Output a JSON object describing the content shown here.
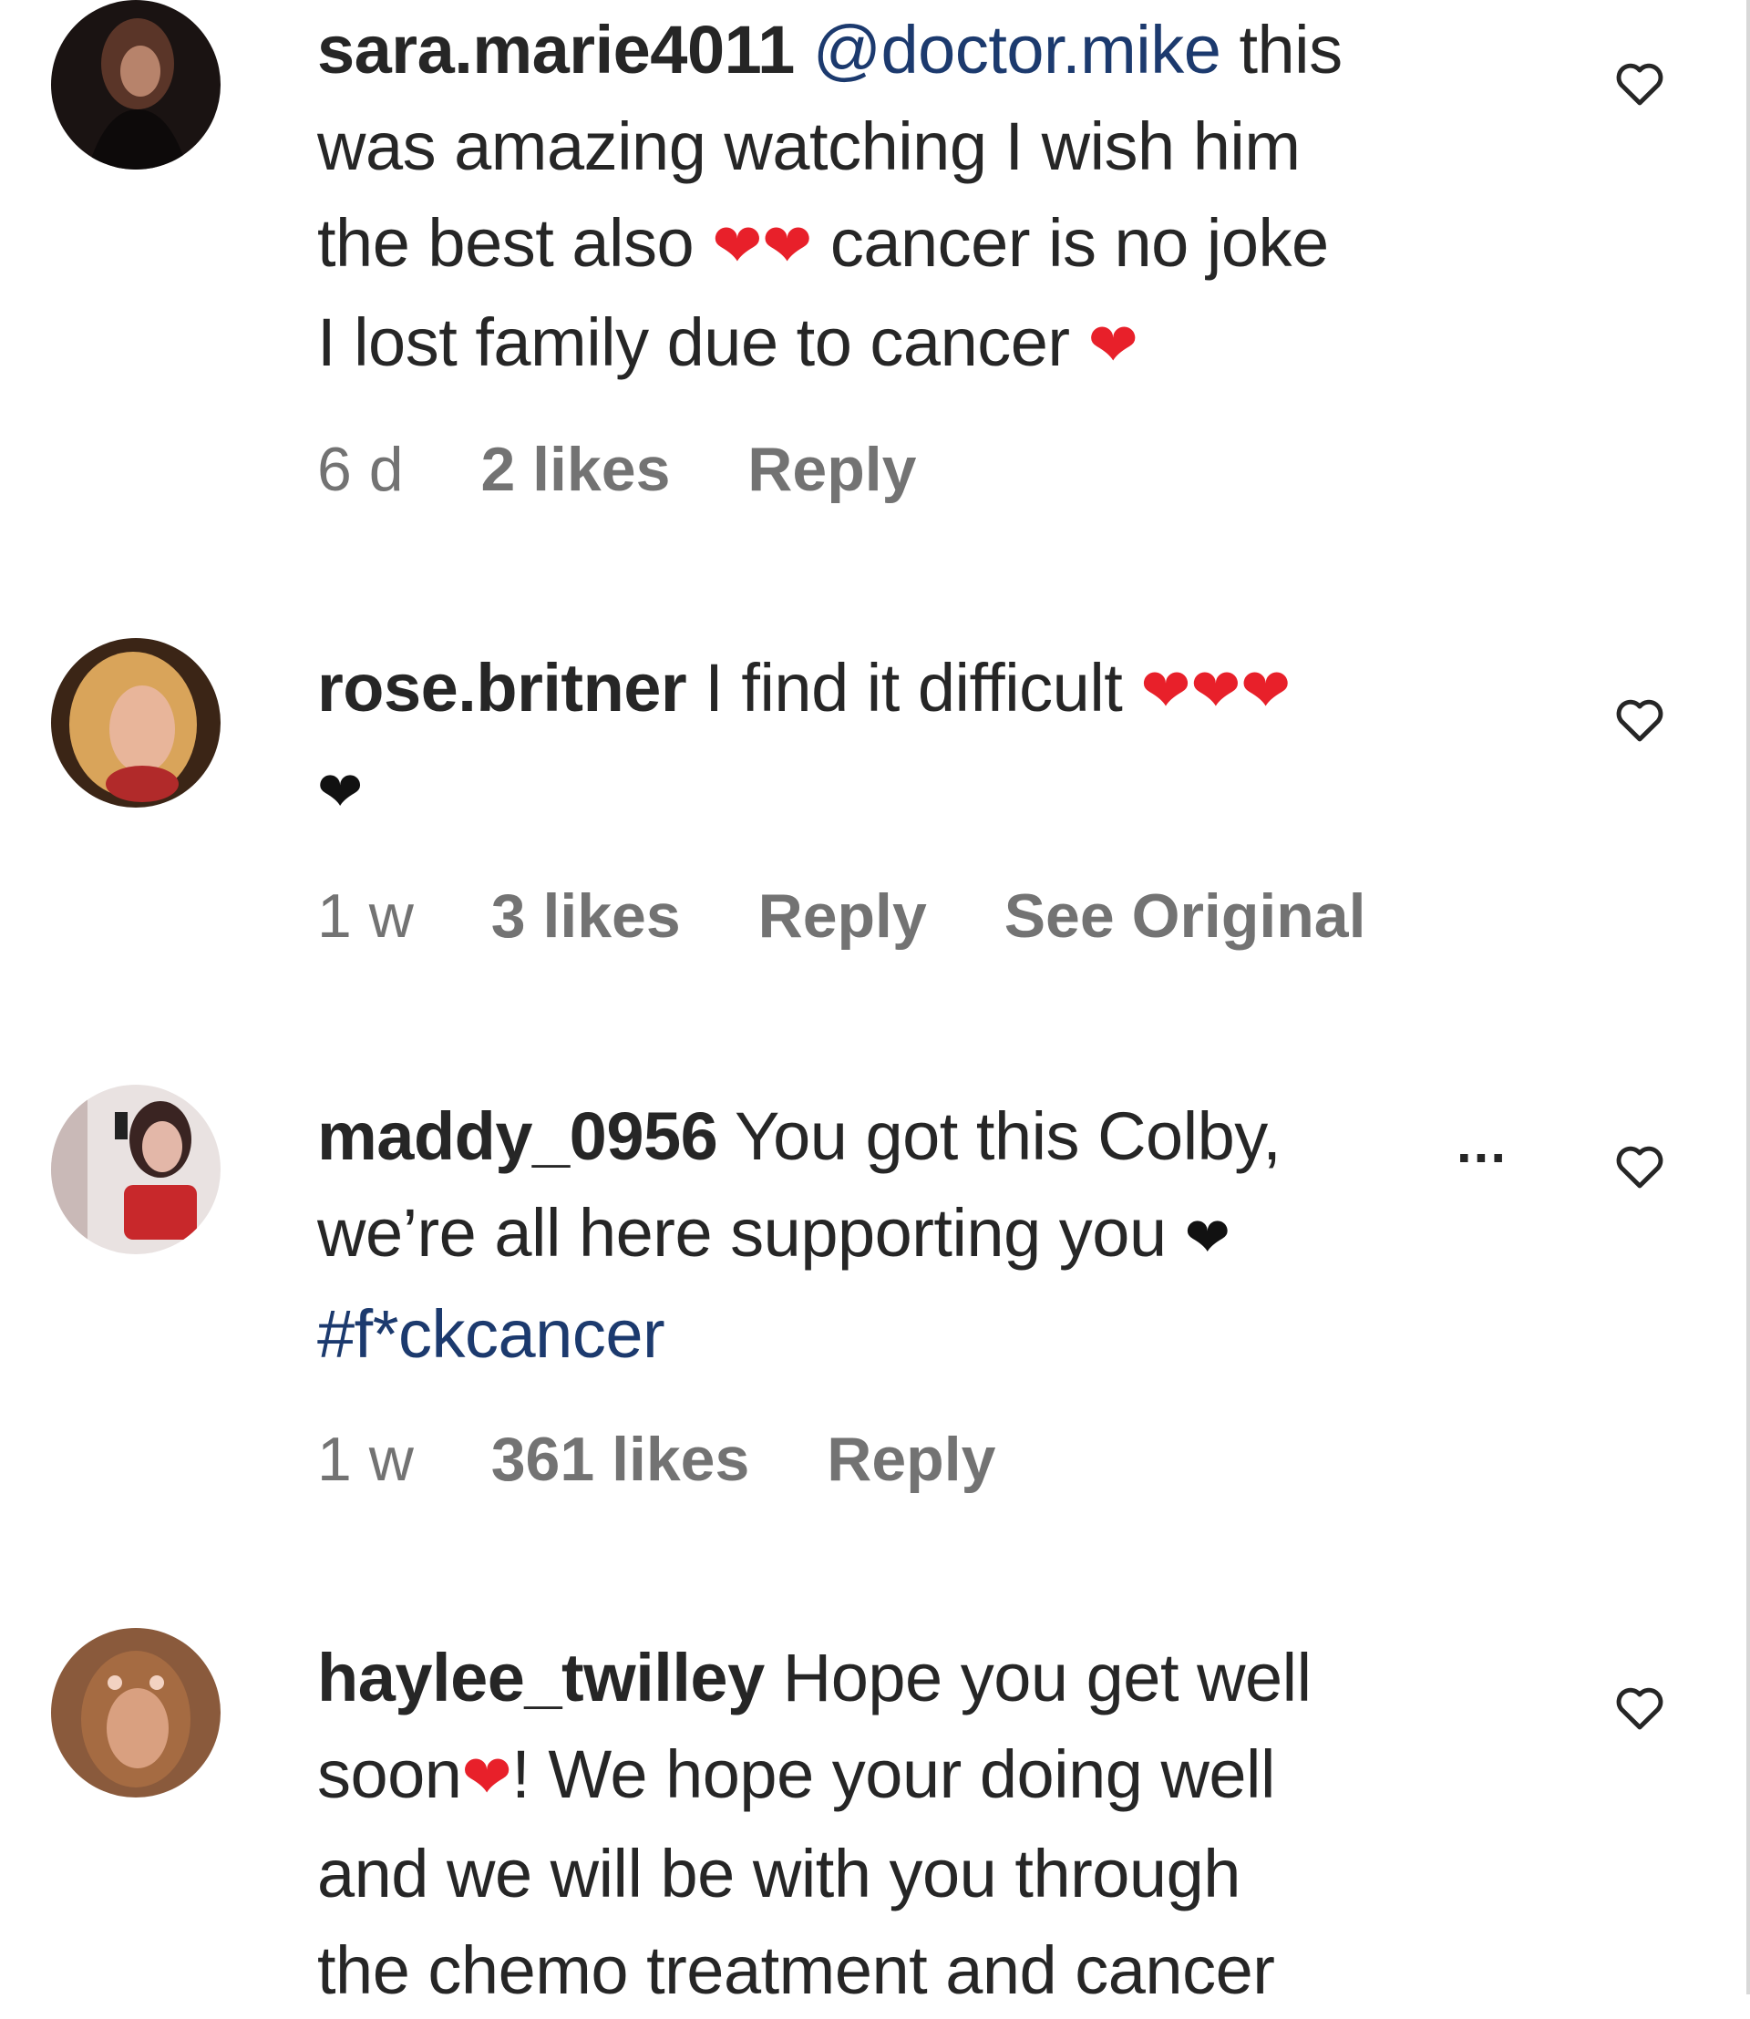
{
  "comments": [
    {
      "username": "sara.marie4011",
      "mention": "@doctor.mike",
      "text_1": "this",
      "text_2": "was amazing watching I wish him",
      "text_3": "the best also",
      "text_4": "cancer is no joke",
      "text_5": "I lost family due to cancer",
      "time": "6 d",
      "likes": "2 likes",
      "reply": "Reply"
    },
    {
      "username": "rose.britner",
      "text_1": "I find it difficult",
      "time": "1 w",
      "likes": "3 likes",
      "reply": "Reply",
      "see_original": "See Original"
    },
    {
      "username": "maddy_0956",
      "text_1": "You got this Colby,",
      "text_2": "we’re all here supporting you",
      "hashtag": "#f*ckcancer",
      "more": "...",
      "time": "1 w",
      "likes": "361 likes",
      "reply": "Reply"
    },
    {
      "username": "haylee_twilley",
      "text_1": "Hope you get well",
      "text_2": "soon",
      "text_3": "! We hope your doing well",
      "text_4": "and we will be with you through",
      "text_5": "the chemo treatment and cancer"
    }
  ],
  "icons": {
    "like": "heart-outline-icon",
    "red_heart": "red-heart-emoji",
    "black_heart": "black-heart-emoji"
  },
  "colors": {
    "text": "#262626",
    "meta": "#737373",
    "link": "#1c3a6e",
    "heart": "#e8202a"
  }
}
